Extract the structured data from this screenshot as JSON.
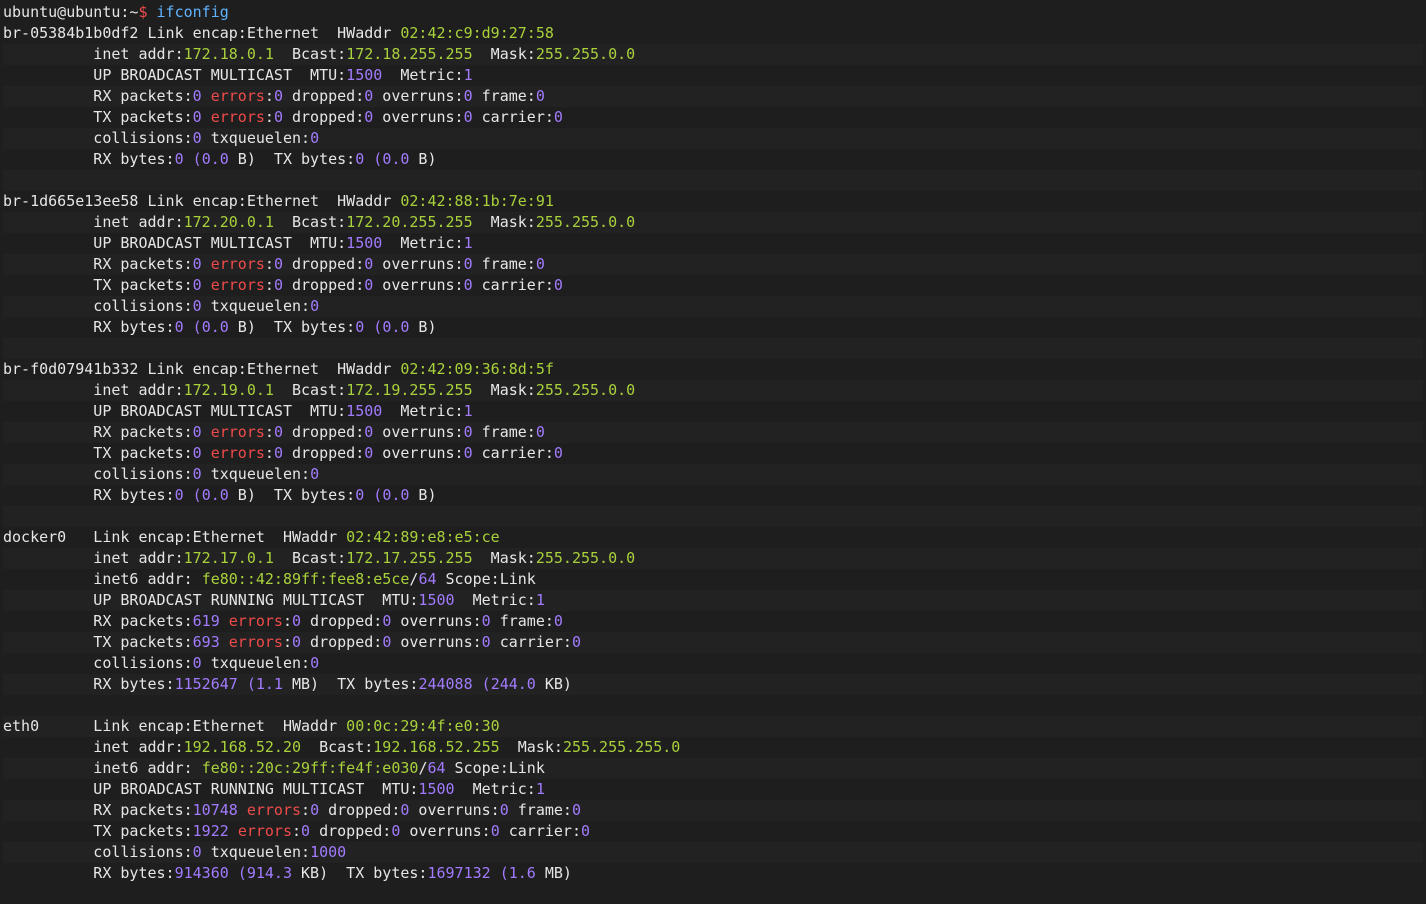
{
  "terminal": {
    "prompt": {
      "user_host": "ubuntu@ubuntu:~",
      "symbol": "$",
      "command": "ifconfig"
    },
    "lines": [
      [
        [
          "br-05384b1b0df2 Link encap:Ethernet  HWaddr ",
          "label"
        ],
        [
          "02:42:c9:d9:27:58",
          "ip"
        ]
      ],
      [
        [
          "          inet addr:",
          "label"
        ],
        [
          "172.18.0.1",
          "ip"
        ],
        [
          "  Bcast:",
          "label"
        ],
        [
          "172.18.255.255",
          "ip"
        ],
        [
          "  Mask:",
          "label"
        ],
        [
          "255.255.0.0",
          "ip"
        ]
      ],
      [
        [
          "          UP BROADCAST MULTICAST  MTU:",
          "label"
        ],
        [
          "1500",
          "num"
        ],
        [
          "  Metric:",
          "label"
        ],
        [
          "1",
          "num"
        ]
      ],
      [
        [
          "          RX packets:",
          "label"
        ],
        [
          "0",
          "num"
        ],
        [
          " ",
          "label"
        ],
        [
          "errors",
          "err"
        ],
        [
          ":",
          "label"
        ],
        [
          "0",
          "num"
        ],
        [
          " dropped:",
          "label"
        ],
        [
          "0",
          "num"
        ],
        [
          " overruns:",
          "label"
        ],
        [
          "0",
          "num"
        ],
        [
          " frame:",
          "label"
        ],
        [
          "0",
          "num"
        ]
      ],
      [
        [
          "          TX packets:",
          "label"
        ],
        [
          "0",
          "num"
        ],
        [
          " ",
          "label"
        ],
        [
          "errors",
          "err"
        ],
        [
          ":",
          "label"
        ],
        [
          "0",
          "num"
        ],
        [
          " dropped:",
          "label"
        ],
        [
          "0",
          "num"
        ],
        [
          " overruns:",
          "label"
        ],
        [
          "0",
          "num"
        ],
        [
          " carrier:",
          "label"
        ],
        [
          "0",
          "num"
        ]
      ],
      [
        [
          "          collisions:",
          "label"
        ],
        [
          "0",
          "num"
        ],
        [
          " txqueuelen:",
          "label"
        ],
        [
          "0",
          "num"
        ]
      ],
      [
        [
          "          RX bytes:",
          "label"
        ],
        [
          "0",
          "num"
        ],
        [
          " (",
          "num"
        ],
        [
          "0.0",
          "num"
        ],
        [
          " B)  TX bytes:",
          "label"
        ],
        [
          "0",
          "num"
        ],
        [
          " (",
          "num"
        ],
        [
          "0.0",
          "num"
        ],
        [
          " B)",
          "label"
        ]
      ],
      [],
      [
        [
          "br-1d665e13ee58 Link encap:Ethernet  HWaddr ",
          "label"
        ],
        [
          "02:42:88:1b:7e:91",
          "ip"
        ]
      ],
      [
        [
          "          inet addr:",
          "label"
        ],
        [
          "172.20.0.1",
          "ip"
        ],
        [
          "  Bcast:",
          "label"
        ],
        [
          "172.20.255.255",
          "ip"
        ],
        [
          "  Mask:",
          "label"
        ],
        [
          "255.255.0.0",
          "ip"
        ]
      ],
      [
        [
          "          UP BROADCAST MULTICAST  MTU:",
          "label"
        ],
        [
          "1500",
          "num"
        ],
        [
          "  Metric:",
          "label"
        ],
        [
          "1",
          "num"
        ]
      ],
      [
        [
          "          RX packets:",
          "label"
        ],
        [
          "0",
          "num"
        ],
        [
          " ",
          "label"
        ],
        [
          "errors",
          "err"
        ],
        [
          ":",
          "label"
        ],
        [
          "0",
          "num"
        ],
        [
          " dropped:",
          "label"
        ],
        [
          "0",
          "num"
        ],
        [
          " overruns:",
          "label"
        ],
        [
          "0",
          "num"
        ],
        [
          " frame:",
          "label"
        ],
        [
          "0",
          "num"
        ]
      ],
      [
        [
          "          TX packets:",
          "label"
        ],
        [
          "0",
          "num"
        ],
        [
          " ",
          "label"
        ],
        [
          "errors",
          "err"
        ],
        [
          ":",
          "label"
        ],
        [
          "0",
          "num"
        ],
        [
          " dropped:",
          "label"
        ],
        [
          "0",
          "num"
        ],
        [
          " overruns:",
          "label"
        ],
        [
          "0",
          "num"
        ],
        [
          " carrier:",
          "label"
        ],
        [
          "0",
          "num"
        ]
      ],
      [
        [
          "          collisions:",
          "label"
        ],
        [
          "0",
          "num"
        ],
        [
          " txqueuelen:",
          "label"
        ],
        [
          "0",
          "num"
        ]
      ],
      [
        [
          "          RX bytes:",
          "label"
        ],
        [
          "0",
          "num"
        ],
        [
          " (",
          "num"
        ],
        [
          "0.0",
          "num"
        ],
        [
          " B)  TX bytes:",
          "label"
        ],
        [
          "0",
          "num"
        ],
        [
          " (",
          "num"
        ],
        [
          "0.0",
          "num"
        ],
        [
          " B)",
          "label"
        ]
      ],
      [],
      [
        [
          "br-f0d07941b332 Link encap:Ethernet  HWaddr ",
          "label"
        ],
        [
          "02:42:09:36:8d:5f",
          "ip"
        ]
      ],
      [
        [
          "          inet addr:",
          "label"
        ],
        [
          "172.19.0.1",
          "ip"
        ],
        [
          "  Bcast:",
          "label"
        ],
        [
          "172.19.255.255",
          "ip"
        ],
        [
          "  Mask:",
          "label"
        ],
        [
          "255.255.0.0",
          "ip"
        ]
      ],
      [
        [
          "          UP BROADCAST MULTICAST  MTU:",
          "label"
        ],
        [
          "1500",
          "num"
        ],
        [
          "  Metric:",
          "label"
        ],
        [
          "1",
          "num"
        ]
      ],
      [
        [
          "          RX packets:",
          "label"
        ],
        [
          "0",
          "num"
        ],
        [
          " ",
          "label"
        ],
        [
          "errors",
          "err"
        ],
        [
          ":",
          "label"
        ],
        [
          "0",
          "num"
        ],
        [
          " dropped:",
          "label"
        ],
        [
          "0",
          "num"
        ],
        [
          " overruns:",
          "label"
        ],
        [
          "0",
          "num"
        ],
        [
          " frame:",
          "label"
        ],
        [
          "0",
          "num"
        ]
      ],
      [
        [
          "          TX packets:",
          "label"
        ],
        [
          "0",
          "num"
        ],
        [
          " ",
          "label"
        ],
        [
          "errors",
          "err"
        ],
        [
          ":",
          "label"
        ],
        [
          "0",
          "num"
        ],
        [
          " dropped:",
          "label"
        ],
        [
          "0",
          "num"
        ],
        [
          " overruns:",
          "label"
        ],
        [
          "0",
          "num"
        ],
        [
          " carrier:",
          "label"
        ],
        [
          "0",
          "num"
        ]
      ],
      [
        [
          "          collisions:",
          "label"
        ],
        [
          "0",
          "num"
        ],
        [
          " txqueuelen:",
          "label"
        ],
        [
          "0",
          "num"
        ]
      ],
      [
        [
          "          RX bytes:",
          "label"
        ],
        [
          "0",
          "num"
        ],
        [
          " (",
          "num"
        ],
        [
          "0.0",
          "num"
        ],
        [
          " B)  TX bytes:",
          "label"
        ],
        [
          "0",
          "num"
        ],
        [
          " (",
          "num"
        ],
        [
          "0.0",
          "num"
        ],
        [
          " B)",
          "label"
        ]
      ],
      [],
      [
        [
          "docker0   Link encap:Ethernet  HWaddr ",
          "label"
        ],
        [
          "02:42:89:e8:e5:ce",
          "ip"
        ]
      ],
      [
        [
          "          inet addr:",
          "label"
        ],
        [
          "172.17.0.1",
          "ip"
        ],
        [
          "  Bcast:",
          "label"
        ],
        [
          "172.17.255.255",
          "ip"
        ],
        [
          "  Mask:",
          "label"
        ],
        [
          "255.255.0.0",
          "ip"
        ]
      ],
      [
        [
          "          inet6 addr: ",
          "label"
        ],
        [
          "fe80::42:89ff:fee8:e5ce",
          "ip"
        ],
        [
          "/",
          "label"
        ],
        [
          "64",
          "num"
        ],
        [
          " Scope:Link",
          "label"
        ]
      ],
      [
        [
          "          UP BROADCAST RUNNING MULTICAST  MTU:",
          "label"
        ],
        [
          "1500",
          "num"
        ],
        [
          "  Metric:",
          "label"
        ],
        [
          "1",
          "num"
        ]
      ],
      [
        [
          "          RX packets:",
          "label"
        ],
        [
          "619",
          "num"
        ],
        [
          " ",
          "label"
        ],
        [
          "errors",
          "err"
        ],
        [
          ":",
          "label"
        ],
        [
          "0",
          "num"
        ],
        [
          " dropped:",
          "label"
        ],
        [
          "0",
          "num"
        ],
        [
          " overruns:",
          "label"
        ],
        [
          "0",
          "num"
        ],
        [
          " frame:",
          "label"
        ],
        [
          "0",
          "num"
        ]
      ],
      [
        [
          "          TX packets:",
          "label"
        ],
        [
          "693",
          "num"
        ],
        [
          " ",
          "label"
        ],
        [
          "errors",
          "err"
        ],
        [
          ":",
          "label"
        ],
        [
          "0",
          "num"
        ],
        [
          " dropped:",
          "label"
        ],
        [
          "0",
          "num"
        ],
        [
          " overruns:",
          "label"
        ],
        [
          "0",
          "num"
        ],
        [
          " carrier:",
          "label"
        ],
        [
          "0",
          "num"
        ]
      ],
      [
        [
          "          collisions:",
          "label"
        ],
        [
          "0",
          "num"
        ],
        [
          " txqueuelen:",
          "label"
        ],
        [
          "0",
          "num"
        ]
      ],
      [
        [
          "          RX bytes:",
          "label"
        ],
        [
          "1152647",
          "num"
        ],
        [
          " (",
          "num"
        ],
        [
          "1.1",
          "num"
        ],
        [
          " MB)  TX bytes:",
          "label"
        ],
        [
          "244088",
          "num"
        ],
        [
          " (",
          "num"
        ],
        [
          "244.0",
          "num"
        ],
        [
          " KB)",
          "label"
        ]
      ],
      [],
      [
        [
          "eth0      Link encap:Ethernet  HWaddr ",
          "label"
        ],
        [
          "00:0c:29:4f:e0:30",
          "ip"
        ]
      ],
      [
        [
          "          inet addr:",
          "label"
        ],
        [
          "192.168.52.20",
          "ip"
        ],
        [
          "  Bcast:",
          "label"
        ],
        [
          "192.168.52.255",
          "ip"
        ],
        [
          "  Mask:",
          "label"
        ],
        [
          "255.255.255.0",
          "ip"
        ]
      ],
      [
        [
          "          inet6 addr: ",
          "label"
        ],
        [
          "fe80::20c:29ff:fe4f:e030",
          "ip"
        ],
        [
          "/",
          "label"
        ],
        [
          "64",
          "num"
        ],
        [
          " Scope:Link",
          "label"
        ]
      ],
      [
        [
          "          UP BROADCAST RUNNING MULTICAST  MTU:",
          "label"
        ],
        [
          "1500",
          "num"
        ],
        [
          "  Metric:",
          "label"
        ],
        [
          "1",
          "num"
        ]
      ],
      [
        [
          "          RX packets:",
          "label"
        ],
        [
          "10748",
          "num"
        ],
        [
          " ",
          "label"
        ],
        [
          "errors",
          "err"
        ],
        [
          ":",
          "label"
        ],
        [
          "0",
          "num"
        ],
        [
          " dropped:",
          "label"
        ],
        [
          "0",
          "num"
        ],
        [
          " overruns:",
          "label"
        ],
        [
          "0",
          "num"
        ],
        [
          " frame:",
          "label"
        ],
        [
          "0",
          "num"
        ]
      ],
      [
        [
          "          TX packets:",
          "label"
        ],
        [
          "1922",
          "num"
        ],
        [
          " ",
          "label"
        ],
        [
          "errors",
          "err"
        ],
        [
          ":",
          "label"
        ],
        [
          "0",
          "num"
        ],
        [
          " dropped:",
          "label"
        ],
        [
          "0",
          "num"
        ],
        [
          " overruns:",
          "label"
        ],
        [
          "0",
          "num"
        ],
        [
          " carrier:",
          "label"
        ],
        [
          "0",
          "num"
        ]
      ],
      [
        [
          "          collisions:",
          "label"
        ],
        [
          "0",
          "num"
        ],
        [
          " txqueuelen:",
          "label"
        ],
        [
          "1000",
          "num"
        ]
      ],
      [
        [
          "          RX bytes:",
          "label"
        ],
        [
          "914360",
          "num"
        ],
        [
          " (",
          "num"
        ],
        [
          "914.3",
          "num"
        ],
        [
          " KB)  TX bytes:",
          "label"
        ],
        [
          "1697132",
          "num"
        ],
        [
          " (",
          "num"
        ],
        [
          "1.6",
          "num"
        ],
        [
          " MB)",
          "label"
        ]
      ]
    ]
  },
  "colors": {
    "background": "#1e1e1e",
    "text": "#e6e6e6",
    "number": "#a27bff",
    "address": "#a9d13b",
    "error": "#ef4b4b",
    "command": "#5fb3ff"
  }
}
